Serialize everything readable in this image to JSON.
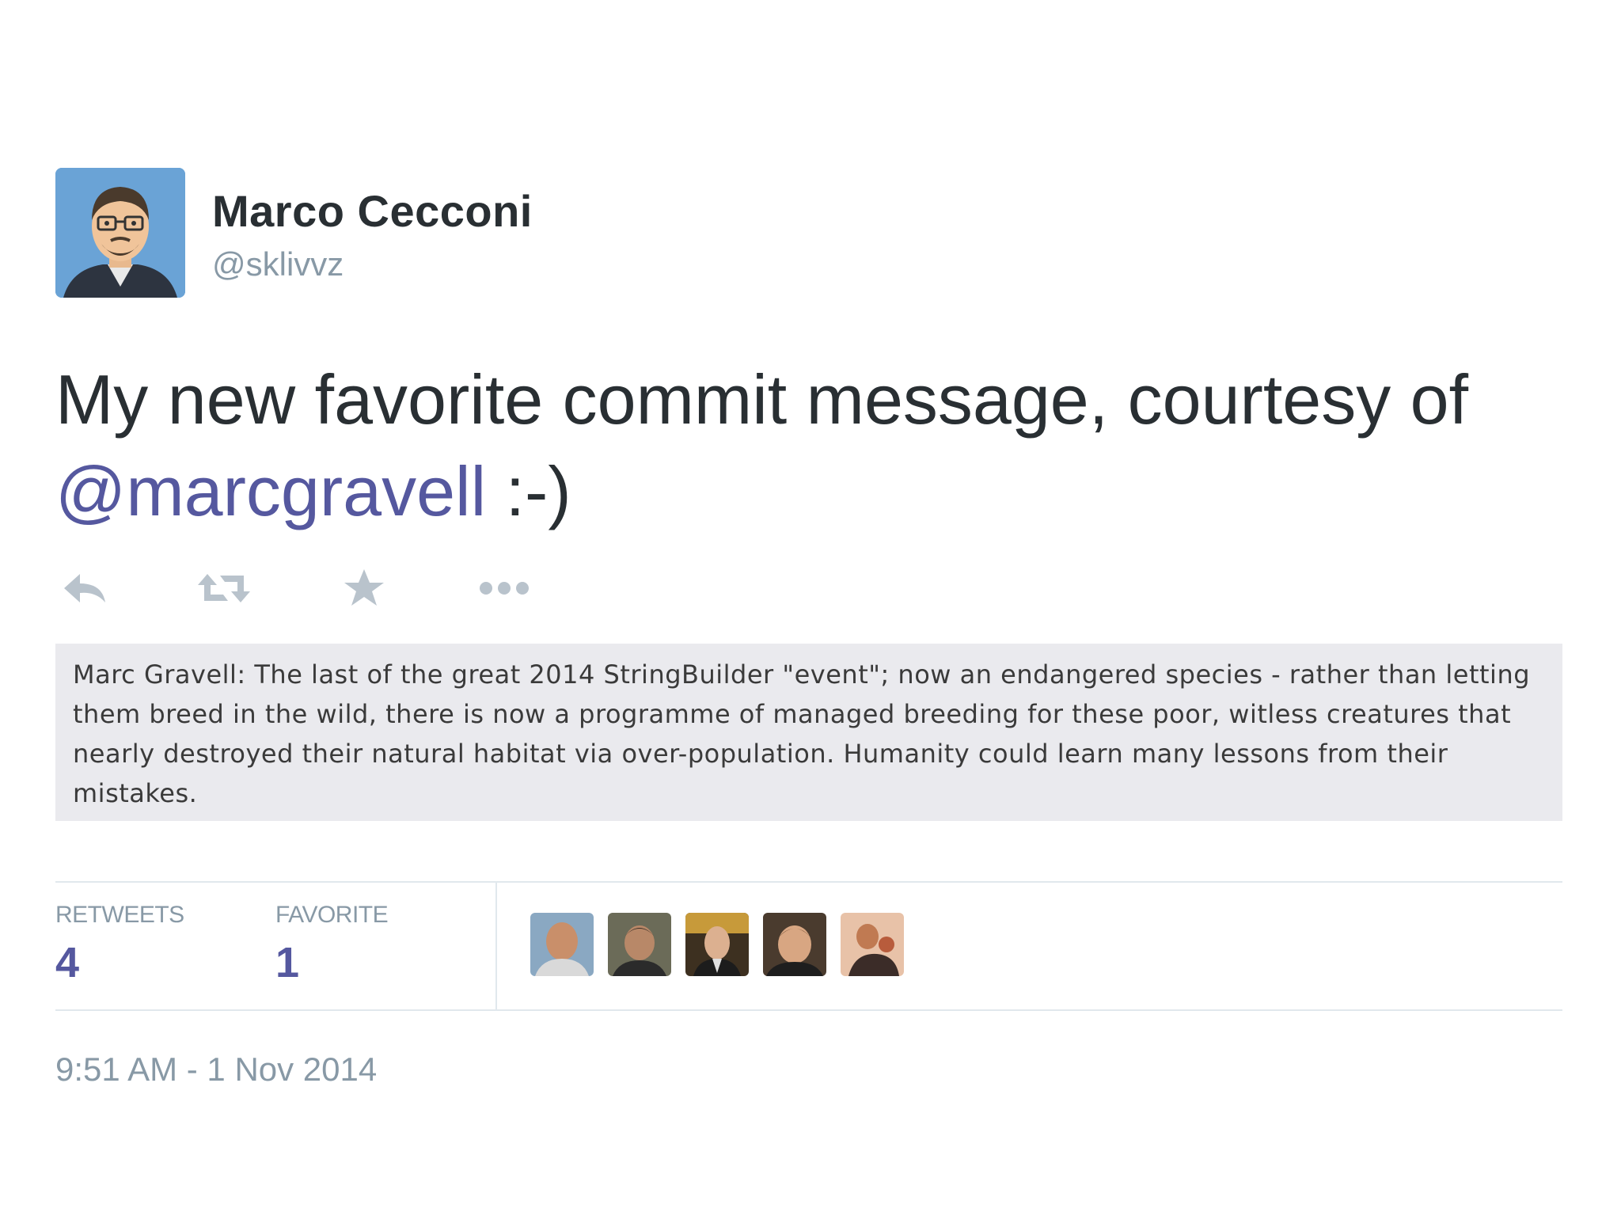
{
  "author": {
    "name": "Marco Cecconi",
    "handle": "@sklivvz",
    "avatar_icon": "cartoon-avatar"
  },
  "tweet": {
    "text_before": "My new favorite commit message, courtesy of ",
    "mention": "@marcgravell",
    "text_after": " :-)"
  },
  "actions": [
    {
      "icon": "reply-icon"
    },
    {
      "icon": "retweet-icon"
    },
    {
      "icon": "favorite-icon"
    },
    {
      "icon": "more-icon"
    }
  ],
  "commit_message": "Marc Gravell: The last of the great 2014 StringBuilder \"event\"; now an endangered species - rather than letting them breed in the wild, there is now a programme of managed breeding for these poor, witless creatures that nearly destroyed their natural habitat via over-population. Humanity could learn many lessons from their mistakes.",
  "stats": {
    "retweets_label": "RETWEETS",
    "retweets_value": "4",
    "favorites_label": "FAVORITE",
    "favorites_value": "1"
  },
  "timestamp": "9:51 AM - 1 Nov 2014",
  "colors": {
    "mention": "#55589f",
    "muted": "#8899a6",
    "text": "#292f33",
    "commit_bg": "#eaeaee"
  }
}
